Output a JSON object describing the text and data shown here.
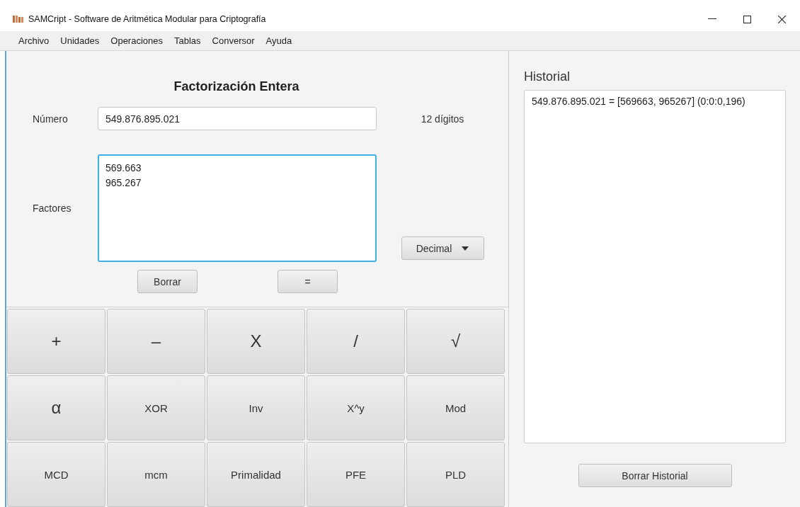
{
  "window": {
    "title": "SAMCript - Software de Aritmética Modular para Criptografía"
  },
  "menu": [
    "Archivo",
    "Unidades",
    "Operaciones",
    "Tablas",
    "Conversor",
    "Ayuda"
  ],
  "form": {
    "heading": "Factorización Entera",
    "number": {
      "label": "Número",
      "value": "549.876.895.021",
      "digits": "12 dígitos"
    },
    "factors": {
      "label": "Factores",
      "lines": [
        "569.663",
        "965.267"
      ],
      "focused": true
    },
    "base": "Decimal",
    "buttons": [
      "Borrar",
      "="
    ]
  },
  "keypad": [
    {
      "label": "+",
      "kind": "symbol"
    },
    {
      "label": "–",
      "kind": "symbol"
    },
    {
      "label": "X",
      "kind": "symbol"
    },
    {
      "label": "/",
      "kind": "symbol"
    },
    {
      "label": "√",
      "kind": "symbol"
    },
    {
      "label": "α",
      "kind": "symbol"
    },
    {
      "label": "XOR",
      "kind": "word"
    },
    {
      "label": "Inv",
      "kind": "word"
    },
    {
      "label": "X^y",
      "kind": "word"
    },
    {
      "label": "Mod",
      "kind": "word"
    },
    {
      "label": "MCD",
      "kind": "word"
    },
    {
      "label": "mcm",
      "kind": "word"
    },
    {
      "label": "Primalidad",
      "kind": "word"
    },
    {
      "label": "PFE",
      "kind": "word"
    },
    {
      "label": "PLD",
      "kind": "word"
    }
  ],
  "history": {
    "title": "Historial",
    "entries": [
      "549.876.895.021 = [569663, 965267] (0:0:0,196)"
    ],
    "clear_button": "Borrar Historial"
  }
}
